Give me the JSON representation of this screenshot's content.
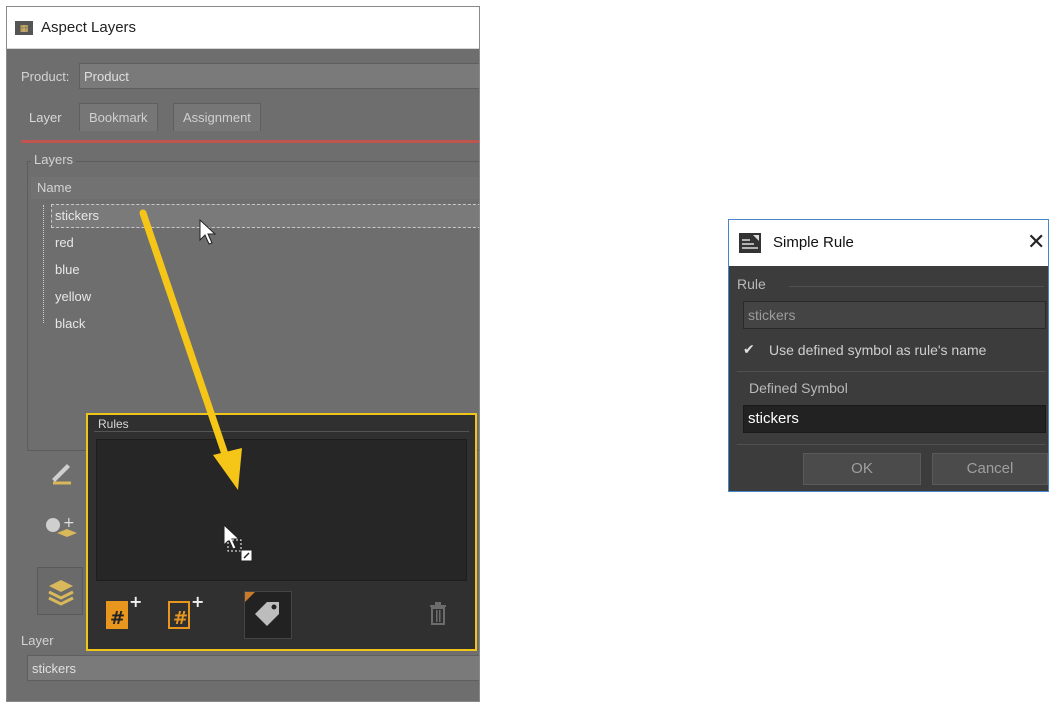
{
  "aspect_layers": {
    "title": "Aspect Layers",
    "icon": "aspect-layers-app-icon",
    "product_label": "Product:",
    "product_value": "Product",
    "tabs": [
      {
        "label": "Layer",
        "active": true
      },
      {
        "label": "Bookmark",
        "active": false
      },
      {
        "label": "Assignment",
        "active": false
      }
    ],
    "layers_group_title": "Layers",
    "column_header": "Name",
    "tree_items": [
      "stickers",
      "red",
      "blue",
      "yellow",
      "black"
    ],
    "selected_item": "stickers",
    "rules_title": "Rules",
    "rule_buttons": [
      "add-rule-icon",
      "add-rule-outline-icon",
      "tag-icon",
      "trash-icon"
    ],
    "side_buttons": [
      "edit-layer-icon",
      "add-layer-icon",
      "layers-stack-icon"
    ],
    "layer_label": "Layer",
    "layer_value": "stickers",
    "accent_color": "#f0c419"
  },
  "simple_rule": {
    "title": "Simple Rule",
    "icon": "simple-rule-icon",
    "close_glyph": "✕",
    "rule_label": "Rule",
    "rule_value": "stickers",
    "checkbox_label": "Use defined symbol as rule's name",
    "checkbox_checked": true,
    "defined_symbol_label": "Defined Symbol",
    "defined_symbol_value": "stickers",
    "ok_label": "OK",
    "cancel_label": "Cancel"
  },
  "annotation": {
    "arrow_color": "#f5c518"
  }
}
